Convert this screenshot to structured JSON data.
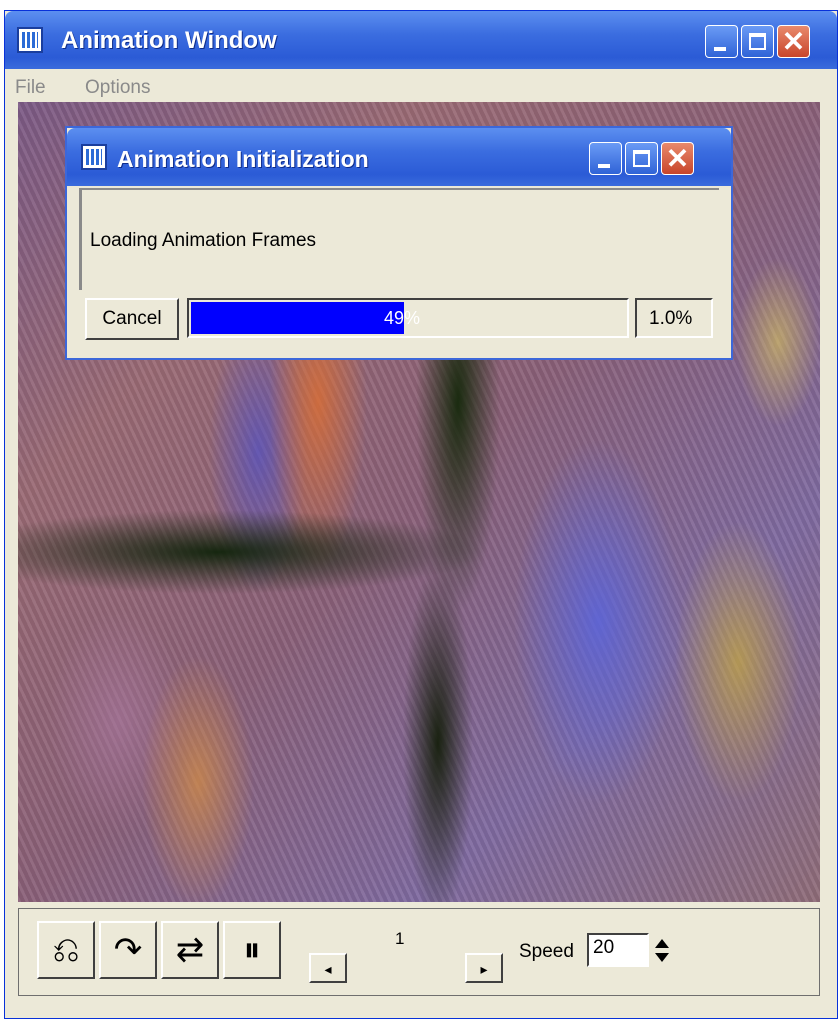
{
  "main_window": {
    "title": "Animation Window",
    "menu": [
      "File",
      "Options"
    ],
    "controls": {
      "rewind_icon": "rewind-loop-icon",
      "forward_icon": "forward-loop-icon",
      "loop_icon": "swap-arrows-icon",
      "pause_icon": "pause-icon",
      "frame_number": "1",
      "speed_label": "Speed",
      "speed_value": "20"
    }
  },
  "dialog": {
    "title": "Animation Initialization",
    "message": "Loading Animation Frames",
    "cancel_label": "Cancel",
    "progress_label": "49%",
    "progress_fraction": 0.49,
    "percent_text": "1.0%"
  },
  "colors": {
    "titlebar": "#2b5bd6",
    "progress": "#0000ff",
    "window_bg": "#ece9d8"
  }
}
